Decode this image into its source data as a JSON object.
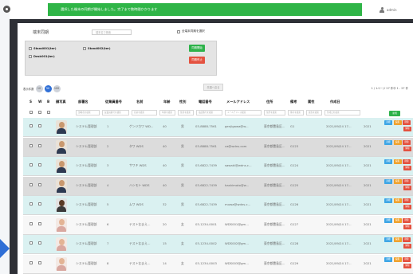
{
  "banner": "選択した端末の同期が開始しました。完了まで数時間かかります",
  "account": {
    "name": "admin"
  },
  "terminal_panel": {
    "title": "端末同期",
    "search_placeholder": "端末名で検索",
    "select_all": "全端末同期を選択",
    "items": [
      "Stand001(ter)",
      "Stand002(ter)",
      "Desk001(ter)"
    ],
    "start_button": "同期開始",
    "stop_button": "同期停止"
  },
  "pagination": {
    "label": "表示件数",
    "sizes": [
      "10",
      "50",
      "100"
    ],
    "active_size": "50",
    "top_button": "先頭へ戻る",
    "info": "1 / 1ページ 27 件中 1 - 27 件"
  },
  "table": {
    "headers": {
      "s": "S",
      "w": "W",
      "b": "B",
      "photo": "顔写真",
      "dept": "部署名",
      "emp_no": "従業員番号",
      "name": "名前",
      "age": "年齢",
      "sex": "性別",
      "phone": "電話番号",
      "email": "メールアドレス",
      "address": "住所",
      "note": "備考",
      "tag": "属性",
      "created": "作成日"
    },
    "filter_placeholders": [
      "部署名を検索",
      "従業員番号を検索",
      "名前を検索",
      "年齢を検索",
      "性別を検索",
      "電話番号を検索",
      "メールアドレス検索",
      "住所を検索",
      "備考を検索",
      "属性を検索",
      "作成日を検索"
    ],
    "add_button": "新規",
    "row_buttons": {
      "detail": "詳細",
      "edit": "編集",
      "delete": "削除",
      "remove": "解除"
    },
    "rows": [
      {
        "dept": "システム管理部",
        "emp_no": "1",
        "name": "ゲンジカワ WD...",
        "age": "40",
        "sex": "男",
        "phone": "03-8888-7561",
        "email": "genjigawa@w...",
        "address": "東京都豊島区...",
        "note": "G1",
        "created": "2021/09/24 17...",
        "extra": "2021",
        "avatar": "man"
      },
      {
        "dept": "システム管理部",
        "emp_no": "2",
        "name": "タワ WDS",
        "age": "40",
        "sex": "男",
        "phone": "03-8888-7561",
        "email": "ca@wdns.com",
        "address": "東京都豊島区...",
        "note": "G123",
        "created": "2021/09/24 17...",
        "extra": "2021",
        "avatar": "man"
      },
      {
        "dept": "システム管理部",
        "emp_no": "3",
        "name": "サワキ WDS",
        "age": "40",
        "sex": "男",
        "phone": "03-6822-7439",
        "email": "sawaki@wdns.c...",
        "address": "東京都豊島区...",
        "note": "G124",
        "created": "2021/09/24 17...",
        "extra": "2021",
        "avatar": "man"
      },
      {
        "dept": "システム管理部",
        "emp_no": "4",
        "name": "ハシモト WDS",
        "age": "40",
        "sex": "男",
        "phone": "03-6822-7439",
        "email": "hashimoto@w...",
        "address": "東京都豊島区...",
        "note": "G125",
        "created": "2021/09/24 17...",
        "extra": "2021",
        "avatar": "man"
      },
      {
        "dept": "システム管理部",
        "emp_no": "5",
        "name": "ムワ WDS",
        "age": "32",
        "sex": "男",
        "phone": "03-6822-7439",
        "email": "muwa@wdns.c...",
        "address": "東京都豊島区...",
        "note": "G126",
        "created": "2021/09/24 17...",
        "extra": "2021",
        "avatar": "dark"
      },
      {
        "dept": "システム管理部",
        "emp_no": "6",
        "name": "テストなまえ...",
        "age": "20",
        "sex": "女",
        "phone": "03-1234-0001",
        "email": "WDS001@gm...",
        "address": "東京都豊島区...",
        "note": "G127",
        "created": "2021/09/24 17...",
        "extra": "2021",
        "avatar": "woman"
      },
      {
        "dept": "システム管理部",
        "emp_no": "7",
        "name": "テストなまえ...",
        "age": "15",
        "sex": "女",
        "phone": "03-1234-0002",
        "email": "WDS002@gm...",
        "address": "東京都豊島区...",
        "note": "G128",
        "created": "2021/09/24 17...",
        "extra": "2021",
        "avatar": "woman"
      },
      {
        "dept": "システム管理部",
        "emp_no": "8",
        "name": "テストなまえ...",
        "age": "14",
        "sex": "女",
        "phone": "03-1234-0003",
        "email": "WDS003@gm...",
        "address": "東京都豊島区...",
        "note": "G129",
        "created": "2021/09/24 17...",
        "extra": "2021",
        "avatar": "woman"
      }
    ]
  },
  "colors": {
    "banner": "#2fb547",
    "accent": "#2f6fd6",
    "start": "#2db24a",
    "stop": "#e4513f",
    "teal_row": "#daf1f1",
    "grey_row": "#dcdcdc"
  }
}
